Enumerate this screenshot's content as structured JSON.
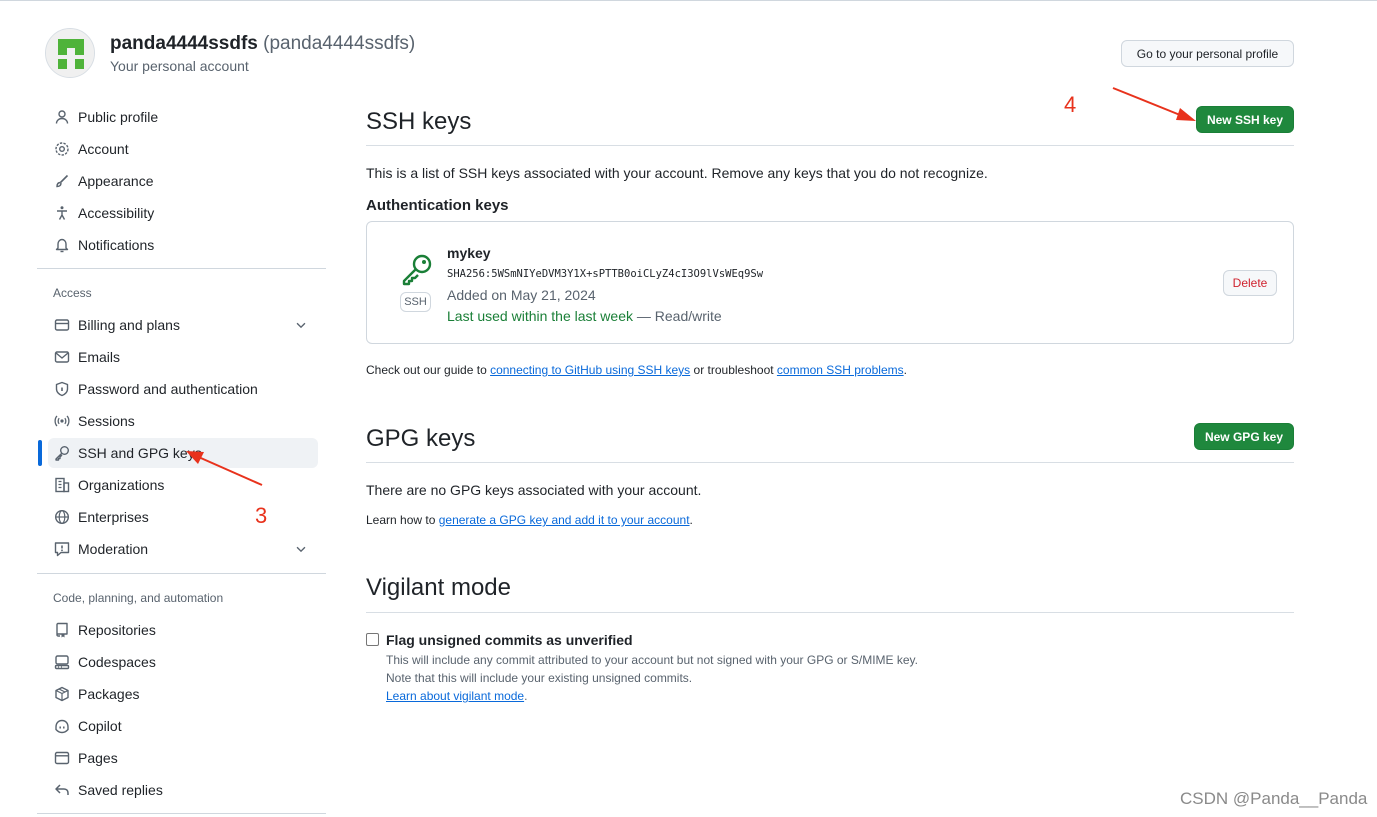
{
  "account": {
    "name": "panda4444ssdfs",
    "login": "(panda4444ssdfs)",
    "subtitle": "Your personal account",
    "profile_button": "Go to your personal profile"
  },
  "sidebar": {
    "group1": [
      {
        "label": "Public profile",
        "icon": "person-icon"
      },
      {
        "label": "Account",
        "icon": "gear-icon"
      },
      {
        "label": "Appearance",
        "icon": "paintbrush-icon"
      },
      {
        "label": "Accessibility",
        "icon": "accessibility-icon"
      },
      {
        "label": "Notifications",
        "icon": "bell-icon"
      }
    ],
    "heading_access": "Access",
    "group2": [
      {
        "label": "Billing and plans",
        "icon": "credit-card-icon",
        "expandable": true
      },
      {
        "label": "Emails",
        "icon": "mail-icon"
      },
      {
        "label": "Password and authentication",
        "icon": "shield-lock-icon"
      },
      {
        "label": "Sessions",
        "icon": "broadcast-icon"
      },
      {
        "label": "SSH and GPG keys",
        "icon": "key-icon",
        "active": true
      },
      {
        "label": "Organizations",
        "icon": "organization-icon"
      },
      {
        "label": "Enterprises",
        "icon": "globe-icon"
      },
      {
        "label": "Moderation",
        "icon": "report-icon",
        "expandable": true
      }
    ],
    "heading_code": "Code, planning, and automation",
    "group3": [
      {
        "label": "Repositories",
        "icon": "repo-icon"
      },
      {
        "label": "Codespaces",
        "icon": "codespaces-icon"
      },
      {
        "label": "Packages",
        "icon": "package-icon"
      },
      {
        "label": "Copilot",
        "icon": "copilot-icon"
      },
      {
        "label": "Pages",
        "icon": "browser-icon"
      },
      {
        "label": "Saved replies",
        "icon": "reply-icon"
      }
    ]
  },
  "ssh": {
    "title": "SSH keys",
    "new_button": "New SSH key",
    "description": "This is a list of SSH keys associated with your account. Remove any keys that you do not recognize.",
    "auth_heading": "Authentication keys",
    "key": {
      "title": "mykey",
      "fingerprint": "SHA256:5WSmNIYeDVM3Y1X+sPTTB0oiCLyZ4cI3O9lVsWEq9Sw",
      "added": "Added on May 21, 2024",
      "last_used": "Last used within the last week",
      "access": " — Read/write",
      "badge": "SSH",
      "delete_button": "Delete"
    },
    "guide_prefix": "Check out our guide to ",
    "guide_link1": "connecting to GitHub using SSH keys",
    "guide_middle": " or troubleshoot ",
    "guide_link2": "common SSH problems",
    "guide_suffix": "."
  },
  "gpg": {
    "title": "GPG keys",
    "new_button": "New GPG key",
    "empty": "There are no GPG keys associated with your account.",
    "learn_prefix": "Learn how to ",
    "learn_link": "generate a GPG key and add it to your account",
    "learn_suffix": "."
  },
  "vigilant": {
    "title": "Vigilant mode",
    "checkbox_label": "Flag unsigned commits as unverified",
    "note1": "This will include any commit attributed to your account but not signed with your GPG or S/MIME key.",
    "note2": "Note that this will include your existing unsigned commits.",
    "learn_link": "Learn about vigilant mode",
    "learn_suffix": "."
  },
  "annotations": {
    "step3": "3",
    "step4": "4",
    "arrow_color": "#e8321c"
  },
  "watermark": "CSDN @Panda__Panda",
  "colors": {
    "primary_green": "#1f883d",
    "link_blue": "#0969da",
    "danger_red": "#cf222e",
    "active_indicator": "#0969da"
  }
}
